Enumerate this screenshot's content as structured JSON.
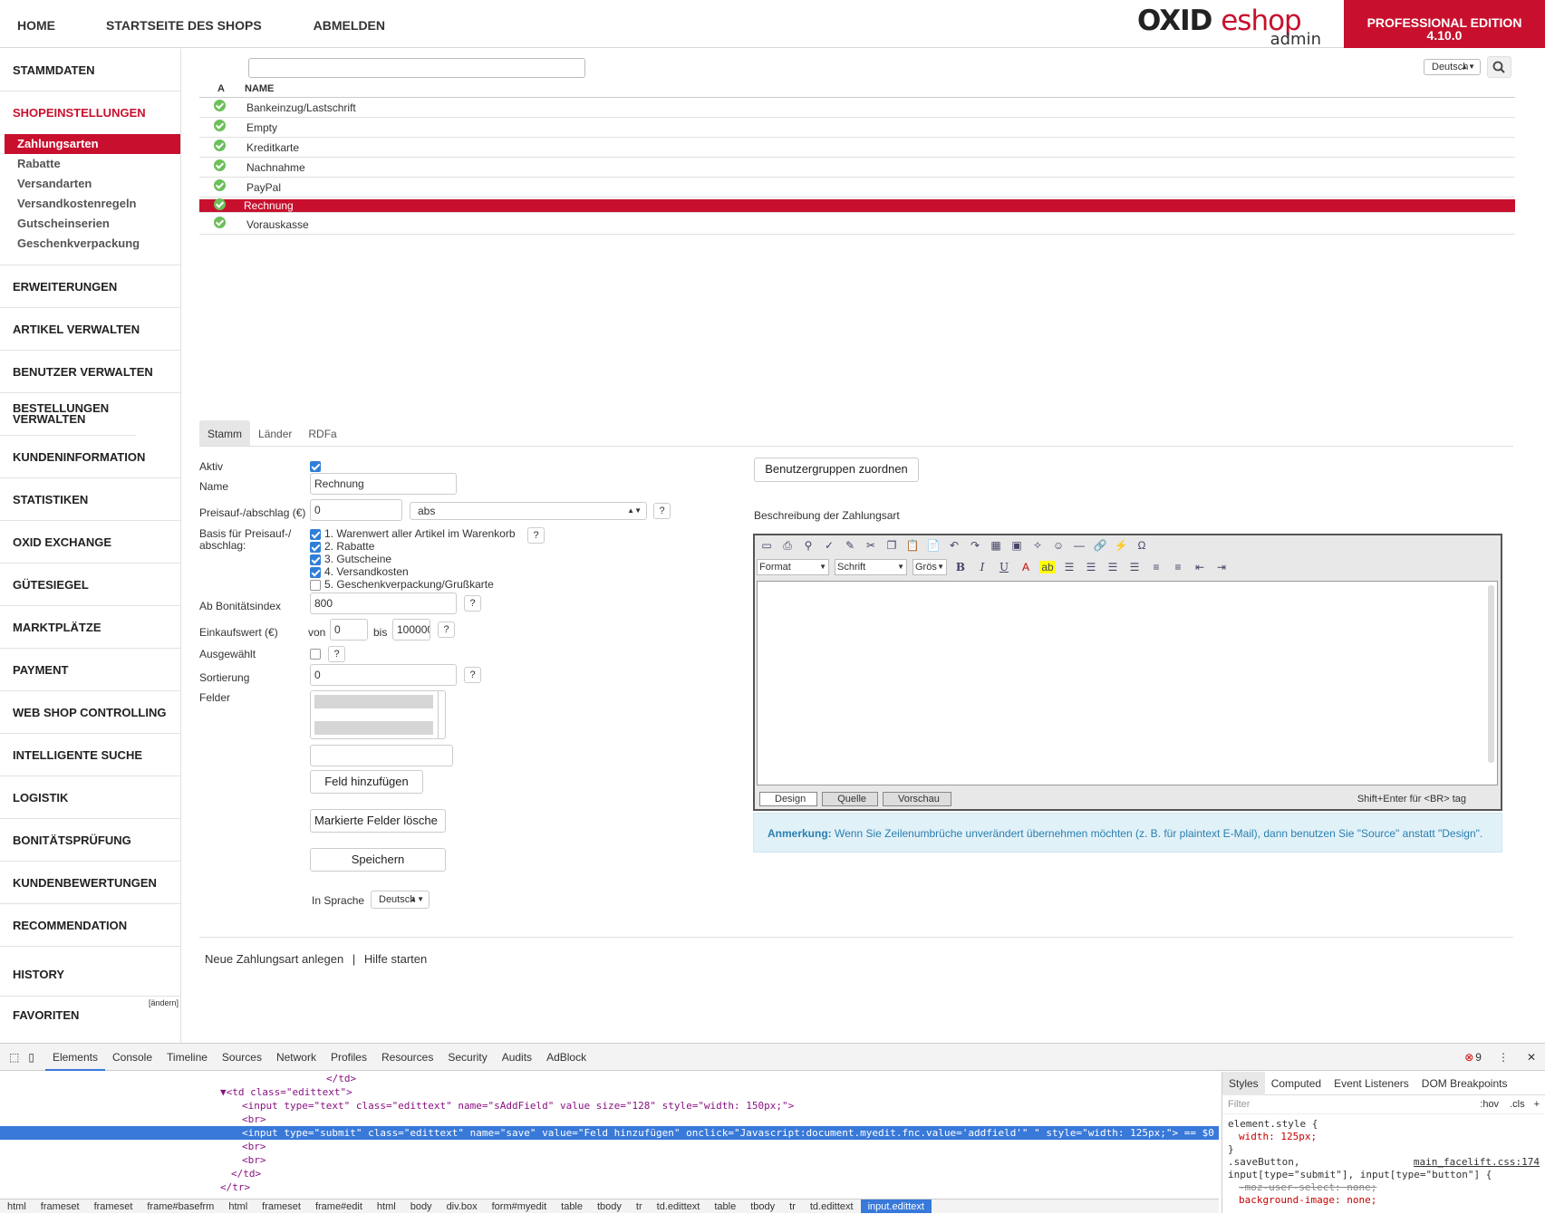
{
  "topnav": {
    "home": "HOME",
    "shop_start": "STARTSEITE DES SHOPS",
    "logout": "ABMELDEN"
  },
  "brand": {
    "oxid": "OXID",
    "eshop": "eshop",
    "admin": "admin",
    "edition_line1": "PROFESSIONAL EDITION",
    "edition_line2": "4.10.0",
    "accent": "#c8102e"
  },
  "sidebar": {
    "stammdaten": "STAMMDATEN",
    "shopeinstellungen": "SHOPEINSTELLUNGEN",
    "sub": [
      "Zahlungsarten",
      "Rabatte",
      "Versandarten",
      "Versandkostenregeln",
      "Gutscheinserien",
      "Geschenkverpackung"
    ],
    "sections": [
      "ERWEITERUNGEN",
      "ARTIKEL VERWALTEN",
      "BENUTZER VERWALTEN",
      "BESTELLUNGEN VERWALTEN",
      "KUNDENINFORMATION",
      "STATISTIKEN",
      "OXID EXCHANGE",
      "GÜTESIEGEL",
      "MARKTPLÄTZE",
      "PAYMENT",
      "WEB SHOP CONTROLLING",
      "INTELLIGENTE SUCHE",
      "LOGISTIK",
      "BONITÄTSPRÜFUNG",
      "KUNDENBEWERTUNGEN",
      "RECOMMENDATION"
    ],
    "history": "HISTORY",
    "favoriten": "FAVORITEN",
    "andern": "[ändern]"
  },
  "list": {
    "lang": "Deutsch",
    "col_a": "A",
    "col_name": "NAME",
    "rows": [
      "Bankeinzug/Lastschrift",
      "Empty",
      "Kreditkarte",
      "Nachnahme",
      "PayPal",
      "Rechnung",
      "Vorauskasse"
    ]
  },
  "tabs": [
    "Stamm",
    "Länder",
    "RDFa"
  ],
  "form": {
    "aktiv": "Aktiv",
    "name_label": "Name",
    "name_value": "Rechnung",
    "preis_label": "Preisauf-/abschlag (€)",
    "preis_value": "0",
    "preis_type": "abs",
    "basis_label1": "Basis für Preisauf-/",
    "basis_label2": "abschlag:",
    "basis_opts": [
      "1. Warenwert aller Artikel im Warenkorb",
      "2. Rabatte",
      "3. Gutscheine",
      "4. Versandkosten",
      "5. Geschenkverpackung/Grußkarte"
    ],
    "bonitaet_label": "Ab Bonitätsindex",
    "bonitaet_value": "800",
    "einkauf_label": "Einkaufswert (€)",
    "von": "von",
    "von_value": "0",
    "bis": "bis",
    "bis_value": "100000",
    "ausgewaehlt": "Ausgewählt",
    "sortierung_label": "Sortierung",
    "sortierung_value": "0",
    "felder": "Felder",
    "feld_hinzufuegen": "Feld hinzufügen",
    "markierte_loeschen": "Markierte Felder lösche",
    "speichern": "Speichern",
    "in_sprache": "In Sprache",
    "sprache": "Deutsch",
    "help": "?"
  },
  "right": {
    "benutzergruppen": "Benutzergruppen zuordnen",
    "beschreibung": "Beschreibung der Zahlungsart",
    "format": "Format",
    "schrift": "Schrift",
    "groesse": "Grös",
    "design": "Design",
    "quelle": "Quelle",
    "vorschau": "Vorschau",
    "shift_hint": "Shift+Enter für <BR> tag",
    "note_bold": "Anmerkung:",
    "note_text": " Wenn Sie Zeilenumbrüche unverändert übernehmen möchten (z. B. für plaintext E-Mail), dann benutzen Sie \"Source\" anstatt \"Design\"."
  },
  "bottom": {
    "neu": "Neue Zahlungsart anlegen",
    "sep": "|",
    "hilfe": "Hilfe starten"
  },
  "devtools": {
    "tabs": [
      "Elements",
      "Console",
      "Timeline",
      "Sources",
      "Network",
      "Profiles",
      "Resources",
      "Security",
      "Audits",
      "AdBlock"
    ],
    "errors": "9",
    "lines": [
      "</td>",
      "▼<td class=\"edittext\">",
      "<input type=\"text\" class=\"edittext\" name=\"sAddField\" value size=\"128\" style=\"width: 150px;\">",
      "<br>",
      "<input type=\"submit\" class=\"edittext\" name=\"save\" value=\"Feld hinzufügen\" onclick=\"Javascript:document.myedit.fnc.value='addfield'\" \" style=\"width: 125px;\"> == $0",
      "<br>",
      "<br>",
      "</td>",
      "</tr>"
    ],
    "crumbs": [
      "html",
      "frameset",
      "frameset",
      "frame#basefrm",
      "html",
      "frameset",
      "frame#edit",
      "html",
      "body",
      "div.box",
      "form#myedit",
      "table",
      "tbody",
      "tr",
      "td.edittext",
      "table",
      "tbody",
      "tr",
      "td.edittext",
      "input.edittext"
    ],
    "style_tabs": [
      "Styles",
      "Computed",
      "Event Listeners",
      "DOM Breakpoints"
    ],
    "filter": "Filter",
    "hov": ":hov",
    "cls": ".cls",
    "style_lines": [
      "element.style {",
      "  width: 125px;",
      "}",
      ".saveButton,",
      "input[type=\"submit\"], input[type=\"button\"] {",
      "  -moz-user-select: none;",
      "  background-image: none;"
    ],
    "source": "main_facelift.css:174"
  }
}
